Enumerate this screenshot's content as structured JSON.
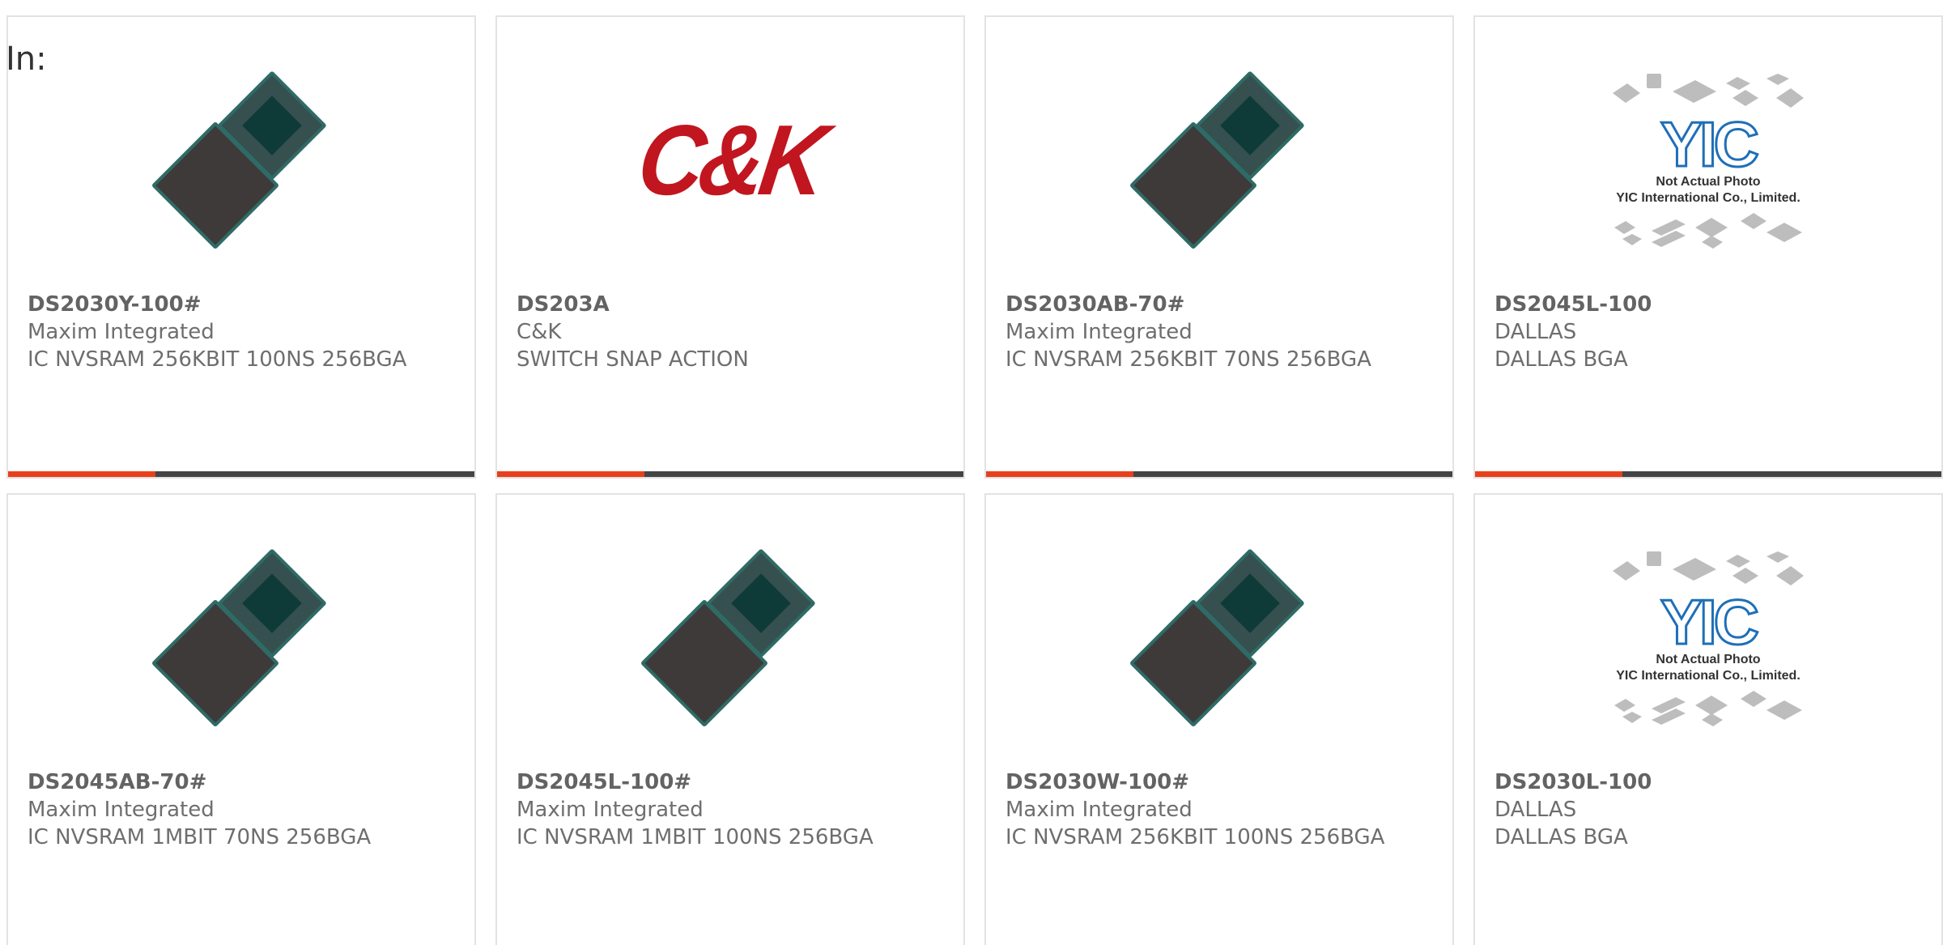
{
  "header": {
    "in_label": "In:"
  },
  "colors": {
    "accent_bar": "#e8401c",
    "bar_base": "#444444",
    "card_border": "#e3e3e3",
    "text": "#6e6e6e",
    "ck_red": "#c1161f"
  },
  "products": [
    {
      "part_number": "DS2030Y-100#",
      "manufacturer": "Maxim Integrated",
      "description": "IC NVSRAM 256KBIT 100NS 256BGA",
      "image_icon": "bga-chip-icon"
    },
    {
      "part_number": "DS203A",
      "manufacturer": "C&K",
      "description": "SWITCH SNAP ACTION",
      "image_icon": "ck-logo-icon",
      "logo_text": "C&K"
    },
    {
      "part_number": "DS2030AB-70#",
      "manufacturer": "Maxim Integrated",
      "description": "IC NVSRAM 256KBIT 70NS 256BGA",
      "image_icon": "bga-chip-icon"
    },
    {
      "part_number": "DS2045L-100",
      "manufacturer": "DALLAS",
      "description": "DALLAS BGA",
      "image_icon": "yic-placeholder-icon",
      "placeholder_line1": "Not Actual Photo",
      "placeholder_line2": "YIC International Co., Limited."
    },
    {
      "part_number": "DS2045AB-70#",
      "manufacturer": "Maxim Integrated",
      "description": "IC NVSRAM 1MBIT 70NS 256BGA",
      "image_icon": "bga-chip-icon"
    },
    {
      "part_number": "DS2045L-100#",
      "manufacturer": "Maxim Integrated",
      "description": "IC NVSRAM 1MBIT 100NS 256BGA",
      "image_icon": "bga-chip-icon"
    },
    {
      "part_number": "DS2030W-100#",
      "manufacturer": "Maxim Integrated",
      "description": "IC NVSRAM 256KBIT 100NS 256BGA",
      "image_icon": "bga-chip-icon"
    },
    {
      "part_number": "DS2030L-100",
      "manufacturer": "DALLAS",
      "description": "DALLAS BGA",
      "image_icon": "yic-placeholder-icon",
      "placeholder_line1": "Not Actual Photo",
      "placeholder_line2": "YIC International Co., Limited."
    }
  ]
}
